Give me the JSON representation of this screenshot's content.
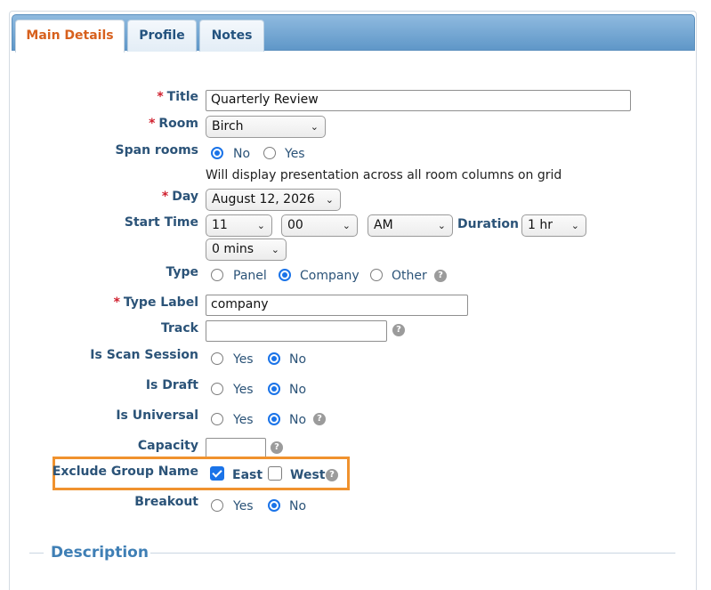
{
  "tabs": [
    {
      "label": "Main Details",
      "active": true
    },
    {
      "label": "Profile",
      "active": false
    },
    {
      "label": "Notes",
      "active": false
    }
  ],
  "form": {
    "title": {
      "label": "Title",
      "value": "Quarterly Review"
    },
    "room": {
      "label": "Room",
      "value": "Birch"
    },
    "span_rooms": {
      "label": "Span rooms",
      "options": [
        "No",
        "Yes"
      ],
      "selected": "No",
      "hint": "Will display presentation across all room columns on grid"
    },
    "day": {
      "label": "Day",
      "value": "August 12, 2026"
    },
    "start_time": {
      "label": "Start Time",
      "hour": "11",
      "minute": "00",
      "ampm": "AM"
    },
    "duration": {
      "label": "Duration",
      "hours": "1 hr",
      "mins": "0 mins"
    },
    "type": {
      "label": "Type",
      "options": [
        "Panel",
        "Company",
        "Other"
      ],
      "selected": "Company"
    },
    "type_label": {
      "label": "Type Label",
      "value": "company"
    },
    "track": {
      "label": "Track",
      "value": ""
    },
    "is_scan_session": {
      "label": "Is Scan Session",
      "options": [
        "Yes",
        "No"
      ],
      "selected": "No"
    },
    "is_draft": {
      "label": "Is Draft",
      "options": [
        "Yes",
        "No"
      ],
      "selected": "No"
    },
    "is_universal": {
      "label": "Is Universal",
      "options": [
        "Yes",
        "No"
      ],
      "selected": "No"
    },
    "capacity": {
      "label": "Capacity",
      "value": ""
    },
    "exclude_group_name": {
      "label": "Exclude Group Name",
      "options": [
        "East",
        "West"
      ],
      "checked": [
        "East"
      ]
    },
    "breakout": {
      "label": "Breakout",
      "options": [
        "Yes",
        "No"
      ],
      "selected": "No"
    }
  },
  "description": {
    "title": "Description"
  },
  "required_marker": "*",
  "help_glyph": "?",
  "colors": {
    "accent": "#1a73e8",
    "label": "#2b5378",
    "active_tab": "#d7601d",
    "highlight": "#f0922e",
    "required": "#d0202e"
  }
}
